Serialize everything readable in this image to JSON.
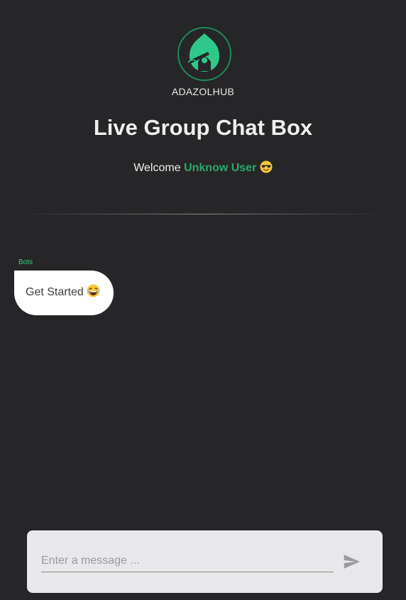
{
  "header": {
    "brand": "ADAZOLHUB",
    "title": "Live Group Chat Box",
    "welcome_prefix": "Welcome",
    "username": "Unknow User",
    "welcome_emoji": "sunglasses-face-emoji"
  },
  "messages": [
    {
      "sender": "Bots",
      "text": "Get Started",
      "emoji": "laughing-face-emoji"
    }
  ],
  "composer": {
    "placeholder": "Enter a message ...",
    "value": "",
    "send_icon": "send-icon"
  },
  "colors": {
    "background": "#262628",
    "accent": "#2aa96a",
    "sender_label": "#33d17a",
    "bubble": "#ffffff",
    "composer": "#e8e8ea"
  }
}
